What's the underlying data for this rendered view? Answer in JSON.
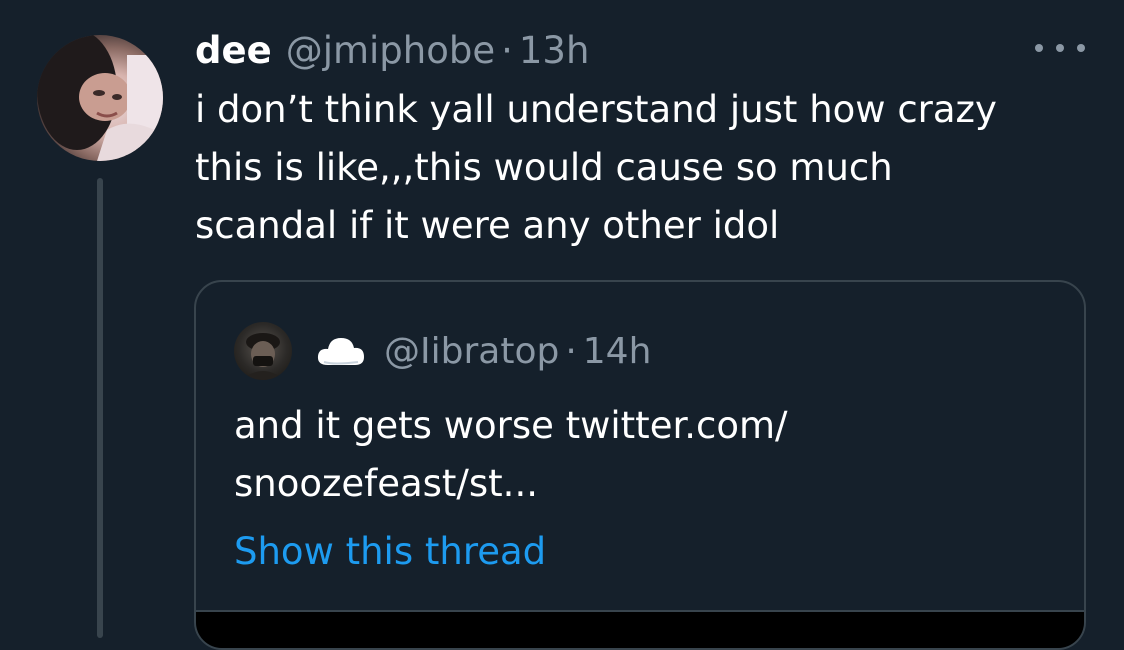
{
  "tweet": {
    "name": "dee",
    "handle": "@jmiphobe",
    "separator": "·",
    "time": "13h",
    "text": "i don’t think yall understand just how crazy\nthis is like,,,this would cause so much\nscandal if it were any other idol"
  },
  "quote": {
    "handle": "@Iibratop",
    "separator": "·",
    "time": "14h",
    "text": "and it gets worse twitter.com/\nsnoozefeast/st...",
    "show_thread": "Show this thread"
  },
  "icons": {
    "more": "more-horizontal-icon",
    "cloud": "cloud-icon"
  },
  "colors": {
    "background": "#15202b",
    "secondary_text": "#8b98a5",
    "link": "#1d9bf0",
    "border": "#38444d"
  }
}
